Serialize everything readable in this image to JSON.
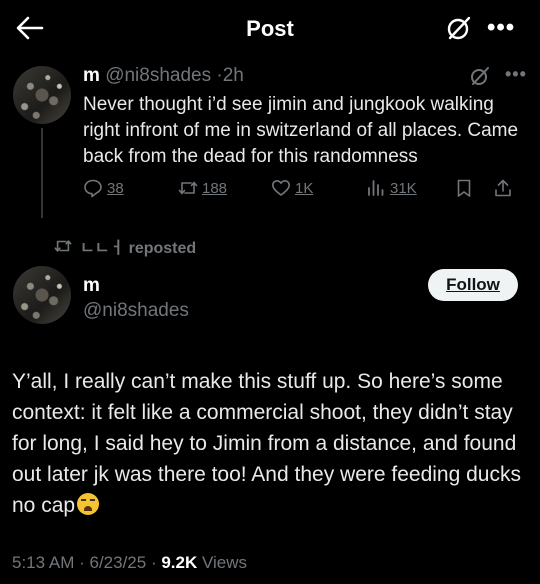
{
  "header": {
    "title": "Post"
  },
  "reply": {
    "name": "m",
    "handle": "@ni8shades",
    "separator": "·",
    "time": "2h",
    "text": "Never thought i’d see jimin and jungkook walking right infront of me in switzerland of all places. Came back from the dead for this randomness",
    "stats": {
      "replies": "38",
      "reposts": "188",
      "likes": "1K",
      "views": "31K"
    }
  },
  "repost_banner": {
    "text": "ㄴㄴㅓ reposted"
  },
  "post": {
    "name": "m",
    "handle": "@ni8shades",
    "follow_label": "Follow",
    "text": "Y’all, I really can’t make this stuff up. So here’s some context: it felt like a commercial shoot, they didn’t stay for long, I said hey to Jimin from a distance, and found out later jk was there too! And they were feeding ducks no cap",
    "time": "5:13 AM",
    "date": "6/23/25",
    "views_count": "9.2K",
    "views_label": "Views"
  },
  "icons": {
    "back": "back-arrow-icon",
    "grok": "grok-icon",
    "more": "more-icon",
    "reply": "reply-icon",
    "repost": "repost-icon",
    "like": "heart-icon",
    "views": "views-icon",
    "bookmark": "bookmark-icon",
    "share": "share-icon",
    "emoji": "loudly-crying-face-icon"
  }
}
